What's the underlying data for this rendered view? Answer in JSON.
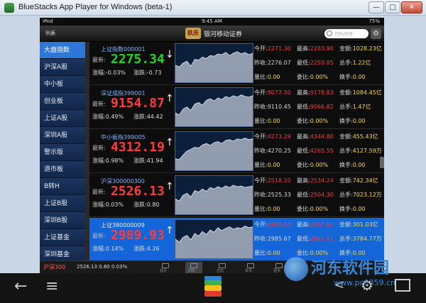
{
  "window": {
    "title": "BlueStacks App Player for Windows (beta-1)",
    "min": "—",
    "max": "□",
    "close": "✕"
  },
  "status": {
    "device": "iPod",
    "time": "9:45 AM",
    "battery": "75%"
  },
  "header": {
    "list_label": "列表",
    "logo_text": "玖乐",
    "brand": "银河移动证券",
    "search_placeholder": "代码/拼音",
    "gear": "⚙"
  },
  "sidebar": {
    "items": [
      {
        "label": "大盘指数",
        "active": true
      },
      {
        "label": "沪深A股"
      },
      {
        "label": "中小板"
      },
      {
        "label": "创业板"
      },
      {
        "label": "上证A股"
      },
      {
        "label": "深圳A股"
      },
      {
        "label": "警示版"
      },
      {
        "label": "退市板"
      },
      {
        "label": "B转H"
      },
      {
        "label": "上证B股"
      },
      {
        "label": "深圳B股"
      },
      {
        "label": "上证基金"
      },
      {
        "label": "深圳基金"
      }
    ]
  },
  "stats_labels": {
    "open": "今开:",
    "high": "最高:",
    "amount": "金额:",
    "prev": "昨收:",
    "low": "最低:",
    "vol": "总手:",
    "buy": "量比:",
    "ratio": "委比:",
    "turnover": "换手:"
  },
  "quotes": [
    {
      "name": "上证指数000001",
      "last_label": "最新:",
      "price": "2275.34",
      "dir": "down",
      "pct_label": "涨幅:",
      "pct": "-0.03%",
      "chg_label": "涨跌:",
      "chg": "-0.73",
      "arrow": "↓",
      "open": "2271.30",
      "high": "2283.90",
      "amount": "1028.23亿",
      "prev": "2276.07",
      "low": "2259.05",
      "vol": "1.22亿",
      "buy": "0.00",
      "ratio": "0.00%",
      "turnover": "0.00",
      "spark": [
        0.45,
        0.4,
        0.5,
        0.55,
        0.42,
        0.6,
        0.58,
        0.66,
        0.62,
        0.7,
        0.68,
        0.74,
        0.72,
        0.78,
        0.7,
        0.76,
        0.8,
        0.74,
        0.78,
        0.72,
        0.76
      ]
    },
    {
      "name": "深证成指399001",
      "last_label": "最新:",
      "price": "9154.87",
      "dir": "up",
      "pct_label": "涨幅:",
      "pct": "0.49%",
      "chg_label": "涨跌:",
      "chg": "44.42",
      "arrow": "↑",
      "open": "9077.50",
      "high": "9178.83",
      "amount": "1084.45亿",
      "prev": "9110.45",
      "low": "9066.82",
      "vol": "1.47亿",
      "buy": "0.00",
      "ratio": "0.00%",
      "turnover": "0.00",
      "spark": [
        0.35,
        0.3,
        0.45,
        0.5,
        0.42,
        0.58,
        0.62,
        0.55,
        0.68,
        0.72,
        0.66,
        0.74,
        0.7,
        0.78,
        0.74,
        0.8,
        0.76,
        0.82,
        0.78,
        0.76,
        0.8
      ]
    },
    {
      "name": "中小板指399005",
      "last_label": "最新:",
      "price": "4312.19",
      "dir": "up",
      "pct_label": "涨幅:",
      "pct": "0.98%",
      "chg_label": "涨跌:",
      "chg": "41.94",
      "arrow": "↑",
      "open": "4273.29",
      "high": "4344.80",
      "amount": "455.43亿",
      "prev": "4270.25",
      "low": "4265.55",
      "vol": "4127.59万",
      "buy": "0.00",
      "ratio": "0.00%",
      "turnover": "0.00",
      "spark": [
        0.3,
        0.28,
        0.4,
        0.5,
        0.55,
        0.6,
        0.58,
        0.66,
        0.7,
        0.65,
        0.72,
        0.75,
        0.7,
        0.78,
        0.8,
        0.76,
        0.82,
        0.8,
        0.84,
        0.8,
        0.82
      ]
    },
    {
      "name": "沪深300000300",
      "last_label": "最新:",
      "price": "2526.13",
      "dir": "up",
      "pct_label": "涨幅:",
      "pct": "0.03%",
      "chg_label": "涨跌:",
      "chg": "0.80",
      "arrow": "↑",
      "open": "2518.10",
      "high": "2534.24",
      "amount": "742.34亿",
      "prev": "2525.33",
      "low": "2504.30",
      "vol": "7023.12万",
      "buy": "0.00",
      "ratio": "0.00%",
      "turnover": "0.00",
      "spark": [
        0.4,
        0.35,
        0.5,
        0.55,
        0.45,
        0.62,
        0.58,
        0.66,
        0.6,
        0.7,
        0.66,
        0.72,
        0.68,
        0.74,
        0.7,
        0.76,
        0.72,
        0.74,
        0.7,
        0.72,
        0.74
      ]
    },
    {
      "name": "上证380000009",
      "last_label": "最新:",
      "price": "2989.93",
      "dir": "up",
      "pct_label": "涨幅:",
      "pct": "0.14%",
      "chg_label": "涨跌:",
      "chg": "4.26",
      "arrow": "↑",
      "open": "2980.43",
      "high": "3007.61",
      "amount": "301.03亿",
      "prev": "2985.67",
      "low": "2961.41",
      "vol": "3784.77万",
      "buy": "0.00",
      "ratio": "0.00%",
      "turnover": "0.00",
      "spark": [
        0.5,
        0.42,
        0.55,
        0.6,
        0.48,
        0.65,
        0.58,
        0.7,
        0.62,
        0.74,
        0.68,
        0.8,
        0.72,
        0.78,
        0.82,
        0.76,
        0.8,
        0.78,
        0.84,
        0.8,
        0.82
      ]
    }
  ],
  "bottom": {
    "index_name": "沪深300",
    "index_value": "2526.13 0.80 0.03%",
    "tabs": [
      "首页",
      "列表",
      "自选",
      "资讯",
      "更多"
    ]
  },
  "navbar": {
    "back": "←",
    "menu": "≡",
    "share": "⋖",
    "settings": "⚙"
  },
  "watermark": {
    "line1": "河东软件园",
    "line2": "www.pc0359.cn"
  },
  "colors": {
    "up": "#ff3a3a",
    "down": "#22d422",
    "accent": "#2d77d6",
    "selected_row": "#1465d8"
  }
}
